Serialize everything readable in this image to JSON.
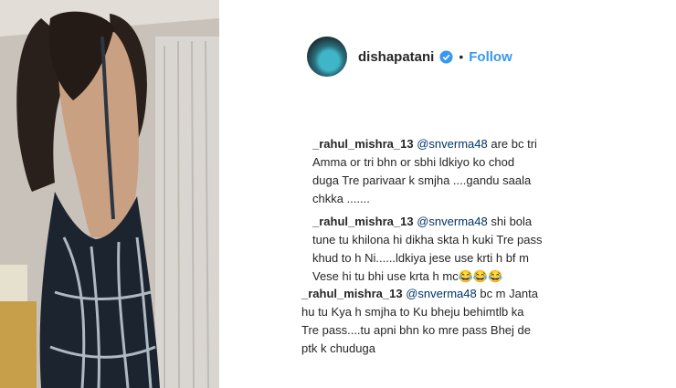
{
  "post": {
    "username": "dishapatani",
    "follow_label": "Follow",
    "separator": "•",
    "avatar_icon": "profile-avatar-icon",
    "verified_icon": "verified-badge-icon",
    "accent_color": "#3897f0"
  },
  "comments": [
    {
      "user": "_rahul_mishra_13",
      "mention": "@snverma48",
      "lines": [
        "are bc tri",
        "Amma or tri bhn or sbhi ldkiyo ko chod",
        "duga Tre parivaar k smjha ....gandu saala",
        "chkka ......."
      ]
    },
    {
      "user": "_rahul_mishra_13",
      "mention": "@snverma48",
      "lines": [
        "shi bola",
        "tune tu khilona hi dikha skta h kuki Tre pass",
        "khud to h Ni......ldkiya jese use krti h bf m",
        "Vese hi tu bhi use krta h mc😂😂😂"
      ]
    },
    {
      "user": "_rahul_mishra_13",
      "mention": "@snverma48",
      "lines": [
        "bc m Janta",
        "hu tu Kya h smjha to Ku bheju behimtlb ka",
        "Tre pass....tu apni bhn ko mre pass Bhej de",
        "ptk k chuduga"
      ]
    }
  ]
}
